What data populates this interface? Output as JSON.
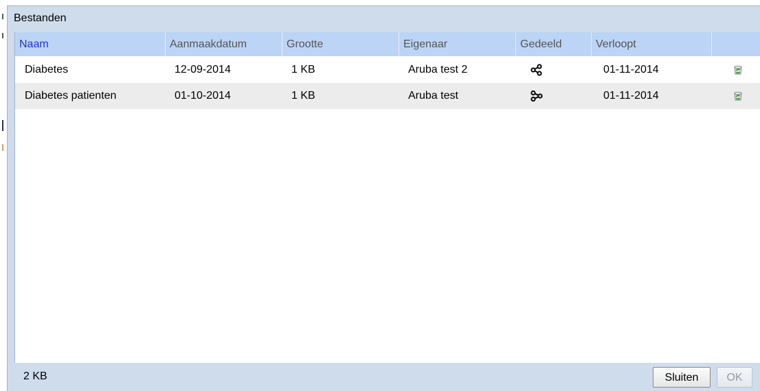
{
  "dialog": {
    "title": "Bestanden"
  },
  "table": {
    "columns": {
      "name": "Naam",
      "created": "Aanmaakdatum",
      "size": "Grootte",
      "owner": "Eigenaar",
      "shared": "Gedeeld",
      "expires": "Verloopt"
    },
    "rows": [
      {
        "name": "Diabetes",
        "created": "12-09-2014",
        "size": "1 KB",
        "owner": "Aruba test 2",
        "shared_icon": "share-icon",
        "expires": "01-11-2014",
        "action_icon": "recycle-bin-icon"
      },
      {
        "name": "Diabetes patienten",
        "created": "01-10-2014",
        "size": "1 KB",
        "owner": "Aruba test",
        "shared_icon": "shared-with-me-icon",
        "expires": "01-11-2014",
        "action_icon": "recycle-bin-icon"
      }
    ]
  },
  "footer": {
    "total_size": "2 KB",
    "close_label": "Sluiten",
    "ok_label": "OK"
  }
}
